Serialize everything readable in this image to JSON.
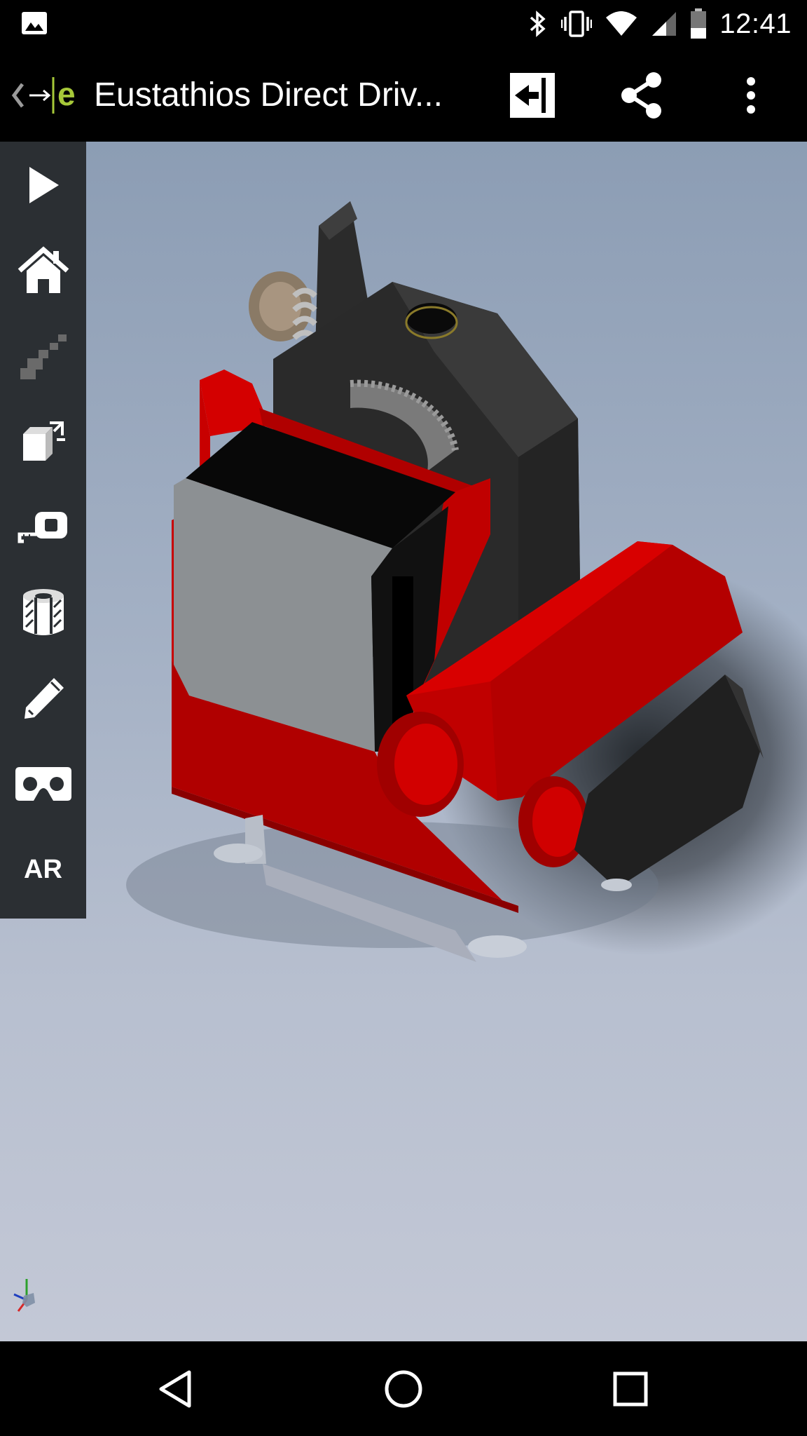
{
  "status_bar": {
    "time": "12:41",
    "icons": [
      "image-icon",
      "bluetooth-icon",
      "vibrate-icon",
      "wifi-icon",
      "signal-icon",
      "battery-icon"
    ]
  },
  "app_bar": {
    "title": "Eustathios Direct Driv...",
    "logo": "edrawings-logo",
    "actions": [
      "exit-view-icon",
      "share-icon",
      "overflow-menu-icon"
    ]
  },
  "toolbar": {
    "items": [
      "play-icon",
      "home-icon",
      "steps-icon",
      "explode-icon",
      "measure-icon",
      "section-icon",
      "markup-icon",
      "vr-headset-icon"
    ],
    "ar_label": "AR"
  },
  "nav_bar": {
    "buttons": [
      "back-icon",
      "home-circle-icon",
      "recents-icon"
    ]
  },
  "colors": {
    "toolbar_bg": "#2b2f33",
    "accent_logo": "#a6c839",
    "part_red": "#c40000",
    "part_black": "#2e2e2e",
    "part_silver": "#a9adb1"
  }
}
